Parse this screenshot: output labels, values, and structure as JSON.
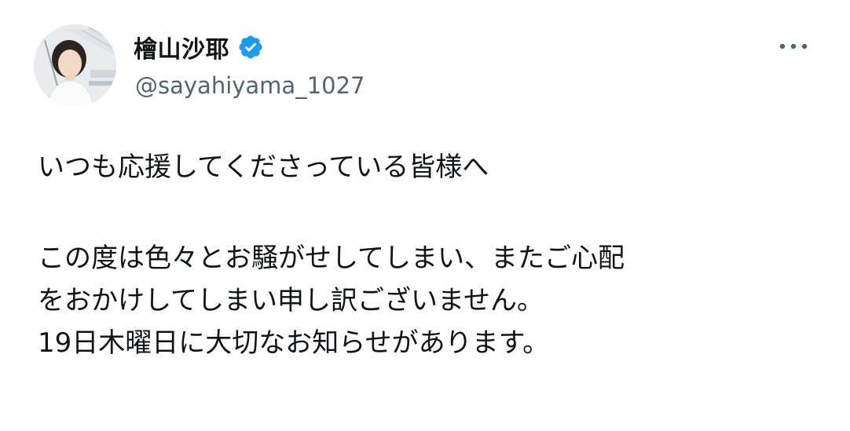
{
  "author": {
    "display_name": "檜山沙耶",
    "handle": "@sayahiyama_1027",
    "verified_icon": "verified-badge-icon",
    "avatar_icon": "profile-photo"
  },
  "menu": {
    "icon": "more-options-icon"
  },
  "tweet": {
    "line1": "いつも応援してくださっている皆様へ",
    "line2": "この度は色々とお騒がせしてしまい、またご心配",
    "line3": "をおかけしてしまい申し訳ございません。",
    "line4": "19日木曜日に大切なお知らせがあります。"
  },
  "colors": {
    "text_primary": "#0f1419",
    "text_secondary": "#536471",
    "verified_blue": "#1d9bf0"
  }
}
